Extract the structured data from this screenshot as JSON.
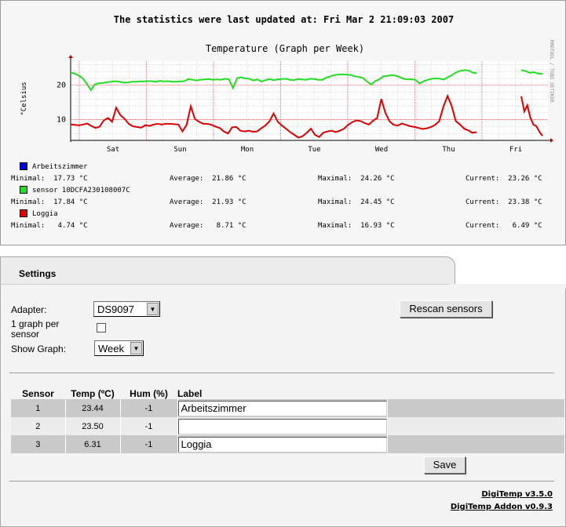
{
  "stats": {
    "updated_text": "The statistics were last updated at: Fri Mar 2 21:09:03 2007"
  },
  "chart_data": {
    "type": "line",
    "title": "Temperature (Graph per Week)",
    "ylabel": "°Celsius",
    "watermark": "RRDTOOL / TOBI OETIKER",
    "ylim": [
      4,
      27
    ],
    "yticks": [
      10,
      20
    ],
    "xticks": [
      "Sat",
      "Sun",
      "Mon",
      "Tue",
      "Wed",
      "Thu",
      "Fri"
    ],
    "grid": true,
    "series": [
      {
        "name": "Arbeitszimmer",
        "color": "#0000dd",
        "values": [],
        "stats": {
          "min": "Minimal:  17.73 °C",
          "avg": "Average:  21.86 °C",
          "max": "Maximal:  24.26 °C",
          "cur": "Current:  23.26 °C"
        }
      },
      {
        "name": "sensor 10DCFA230108007C",
        "color": "#22dd22",
        "values": [
          23.7,
          23.4,
          22.8,
          22.0,
          20.4,
          18.6,
          20.3,
          20.6,
          20.7,
          20.9,
          21.0,
          21.2,
          21.0,
          20.8,
          20.8,
          21.0,
          21.0,
          21.1,
          21.1,
          21.2,
          21.2,
          21.0,
          21.3,
          21.1,
          21.2,
          21.0,
          21.0,
          21.1,
          21.2,
          21.8,
          21.6,
          21.4,
          21.6,
          21.7,
          21.8,
          21.6,
          21.7,
          21.6,
          21.9,
          21.7,
          19.2,
          22.1,
          22.3,
          22.0,
          21.9,
          21.4,
          21.7,
          21.1,
          21.5,
          21.8,
          21.5,
          21.7,
          21.8,
          21.9,
          21.6,
          21.5,
          21.8,
          21.7,
          21.6,
          21.9,
          21.8,
          21.6,
          21.6,
          22.2,
          22.6,
          23.0,
          23.1,
          23.2,
          23.1,
          23.0,
          22.6,
          22.4,
          22.1,
          21.1,
          20.2,
          21.2,
          21.7,
          22.6,
          22.7,
          23.0,
          22.8,
          22.4,
          21.9,
          21.7,
          21.8,
          21.5,
          20.5,
          21.2,
          21.6,
          21.9,
          22.0,
          21.9,
          21.7,
          22.4,
          23.0,
          23.8,
          24.2,
          24.4,
          24.3,
          23.7,
          23.5
        ],
        "extra": [
          24.4,
          24.1,
          23.6,
          23.8,
          23.4,
          23.3
        ]
      },
      {
        "name": "Loggia",
        "color": "#dd0000",
        "values": [
          8.6,
          8.5,
          8.4,
          8.6,
          8.9,
          8.2,
          7.6,
          8.0,
          9.8,
          10.5,
          9.4,
          13.5,
          11.3,
          10.3,
          8.8,
          8.1,
          7.9,
          7.7,
          8.4,
          8.2,
          8.6,
          8.8,
          8.6,
          8.8,
          8.8,
          8.7,
          8.6,
          6.6,
          8.5,
          13.9,
          10.2,
          9.4,
          8.8,
          8.8,
          8.5,
          8.0,
          7.6,
          6.6,
          6.0,
          7.8,
          7.9,
          6.8,
          6.6,
          6.8,
          6.5,
          6.6,
          7.5,
          8.3,
          9.5,
          11.8,
          9.4,
          8.3,
          7.4,
          6.4,
          5.6,
          4.8,
          5.2,
          6.2,
          7.4,
          5.6,
          5.0,
          6.2,
          6.6,
          6.8,
          6.4,
          6.8,
          7.4,
          8.5,
          9.3,
          9.8,
          9.6,
          9.0,
          8.6,
          9.7,
          10.5,
          16.0,
          12.0,
          9.5,
          8.5,
          8.3,
          8.9,
          8.5,
          8.1,
          7.9,
          7.6,
          7.3,
          7.5,
          7.9,
          8.5,
          9.6,
          13.8,
          16.9,
          14.0,
          9.6,
          8.6,
          7.4,
          6.9,
          6.2,
          6.4
        ],
        "extra": [
          16.8,
          12.4,
          14.2,
          10.6,
          8.6,
          8.1,
          6.5,
          5.3
        ]
      }
    ],
    "legend_stats_3": {
      "min": "Minimal:   4.74 °C",
      "avg": "Average:   8.71 °C",
      "max": "Maximal:  16.93 °C",
      "cur": "Current:   6.49 °C"
    }
  },
  "settings": {
    "tab_title": "Settings",
    "adapter_label": "Adapter:",
    "adapter_value": "DS9097",
    "graph_per_sensor_label": "1 graph per sensor",
    "show_graph_label": "Show Graph:",
    "show_graph_value": "Week",
    "rescan_label": "Rescan sensors",
    "save_label": "Save"
  },
  "table": {
    "headers": [
      "Sensor",
      "Temp (ºC)",
      "Hum (%)",
      "Label"
    ],
    "rows": [
      {
        "sensor": "1",
        "temp": "23.44",
        "hum": "-1",
        "label": "Arbeitszimmer"
      },
      {
        "sensor": "2",
        "temp": "23.50",
        "hum": "-1",
        "label": ""
      },
      {
        "sensor": "3",
        "temp": "6.31",
        "hum": "-1",
        "label": "Loggia"
      }
    ]
  },
  "footer": {
    "version1": "DigiTemp v3.5.0",
    "version2": "DigiTemp Addon v0.9.3"
  }
}
